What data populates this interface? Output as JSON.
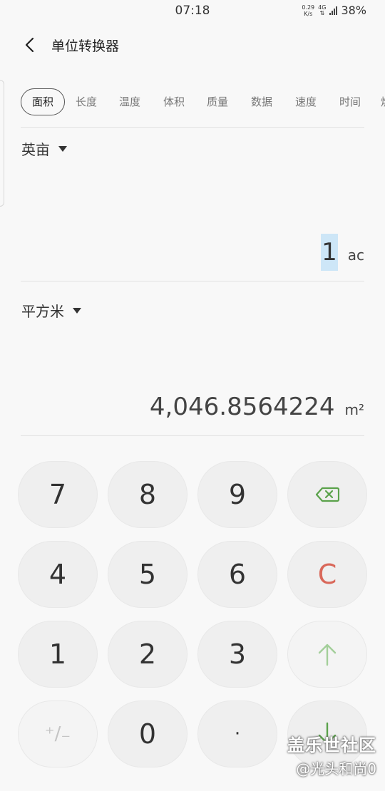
{
  "status_bar": {
    "time": "07:18",
    "net_speed_value": "0.29",
    "net_speed_unit": "K/s",
    "network_type": "4G",
    "battery": "38%"
  },
  "header": {
    "title": "单位转换器"
  },
  "tabs": [
    {
      "label": "面积",
      "active": true
    },
    {
      "label": "长度",
      "active": false
    },
    {
      "label": "温度",
      "active": false
    },
    {
      "label": "体积",
      "active": false
    },
    {
      "label": "质量",
      "active": false
    },
    {
      "label": "数据",
      "active": false
    },
    {
      "label": "速度",
      "active": false
    },
    {
      "label": "时间",
      "active": false
    },
    {
      "label": "燃",
      "active": false
    }
  ],
  "converter": {
    "from_unit_name": "英亩",
    "from_value": "1",
    "from_unit_symbol": "ac",
    "to_unit_name": "平方米",
    "to_value": "4,046.8564224",
    "to_unit_symbol": "m²"
  },
  "keypad": {
    "rows": [
      [
        "7",
        "8",
        "9"
      ],
      [
        "4",
        "5",
        "6"
      ],
      [
        "1",
        "2",
        "3"
      ],
      [
        "+/−",
        "0",
        "·"
      ]
    ],
    "icons": [
      "backspace-icon",
      "clear-icon",
      "arrow-up-icon",
      "arrow-down-icon"
    ],
    "clear_label": "C",
    "plusminus_label": "⁺/₋"
  },
  "watermark": {
    "brand": "盖乐世社区",
    "user": "@光头和尚0"
  },
  "colors": {
    "background": "#f8f8f8",
    "key_bg": "#efefef",
    "clear_red": "#d9685a",
    "arrow_green": "#5aa24a",
    "highlight_blue": "#cde6f7"
  }
}
